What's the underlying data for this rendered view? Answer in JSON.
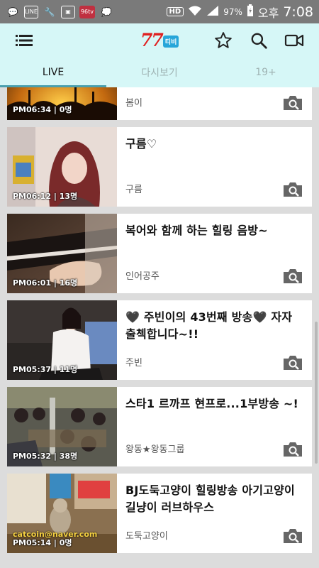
{
  "status_bar": {
    "battery": "97%",
    "ampm": "오후",
    "time": "7:08",
    "hd": "HD",
    "line_label": "LINE",
    "app_badge": "96tv"
  },
  "app": {
    "logo_number": "77",
    "logo_tv": "티비"
  },
  "tabs": [
    {
      "label": "LIVE",
      "active": true
    },
    {
      "label": "다시보기",
      "active": false
    },
    {
      "label": "19+",
      "active": false
    }
  ],
  "broadcasts": [
    {
      "time_viewers": "PM06:34 | 0명",
      "title": "",
      "streamer": "봄이"
    },
    {
      "time_viewers": "PM06:12 | 13명",
      "title": "구름♡",
      "streamer": "구름"
    },
    {
      "time_viewers": "PM06:01 | 16명",
      "title": "복어와 함께 하는 힐링 음방~",
      "streamer": "인어공주"
    },
    {
      "time_viewers": "PM05:37 | 11명",
      "title": "🖤 주빈이의 43번째 방송🖤 자자 출첵합니다~!!",
      "streamer": "주빈"
    },
    {
      "time_viewers": "PM05:32 | 38명",
      "title": "스타1 르까프 현프로...1부방송 ~!",
      "streamer": "왕동★왕동그룹"
    },
    {
      "time_viewers": "PM05:14 | 0명",
      "title": "BJ도둑고양이 힐링방송 아기고양이 길냥이 러브하우스",
      "streamer": "도둑고양이",
      "thumb_text": "catcoin@naver.com"
    }
  ],
  "colors": {
    "appbar_bg": "#d6f7f7",
    "tab_indicator": "#4a9fae",
    "logo_red": "#e02020",
    "logo_blue": "#27a6d9"
  }
}
